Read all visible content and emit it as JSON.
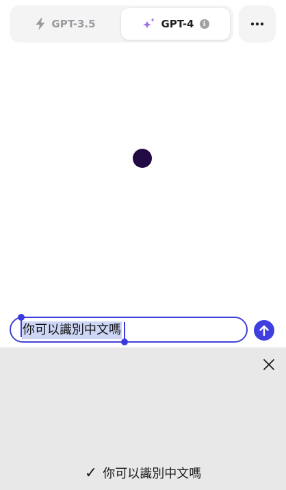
{
  "model_switcher": {
    "tabs": [
      {
        "label": "GPT-3.5",
        "icon": "lightning-icon",
        "selected": false
      },
      {
        "label": "GPT-4",
        "icon": "sparkles-icon",
        "selected": true
      }
    ],
    "info_glyph": "i",
    "more_icon": "more-horizontal-icon"
  },
  "composer": {
    "value": "你可以識別中文嗎",
    "send_icon": "arrow-up-icon"
  },
  "dictation_panel": {
    "close_icon": "close-icon",
    "suggestion_text": "你可以識別中文嗎",
    "confirm_glyph": "✓"
  },
  "colors": {
    "accent": "#3f3fe0",
    "loader": "#220a44",
    "panel_bg": "#e8e8e8",
    "sparkle": "#a070e0"
  }
}
